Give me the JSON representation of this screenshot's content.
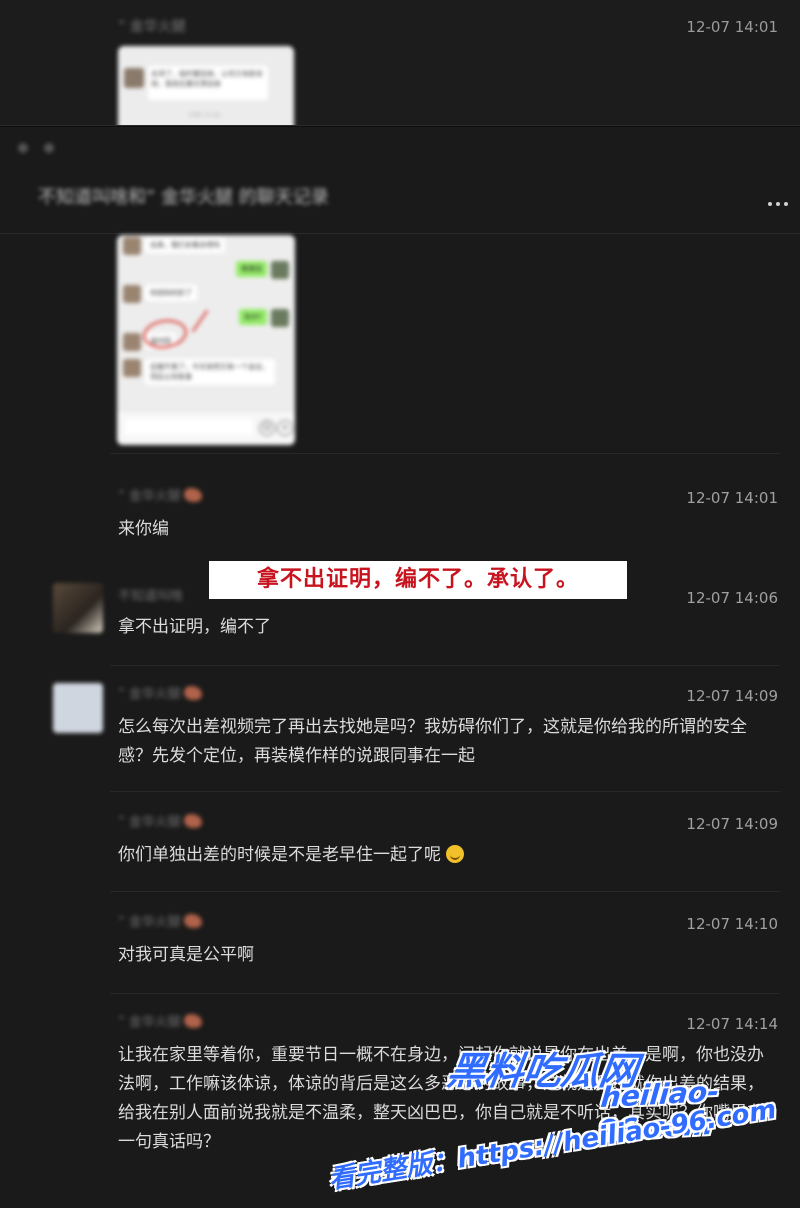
{
  "top_message": {
    "sender": "” 金华火腿",
    "time": "12-07 14:01",
    "thumbnail_text": "去领了，临时要回来，公司又有新安排，我现在要买票回来",
    "thumbnail_footer": "10月 11:41"
  },
  "chat_window": {
    "title": "不知道叫啥和” 金华火腿 的聊天记录",
    "screenshot_messages": [
      {
        "side": "left",
        "text": "出来，我们去看去吧吗"
      },
      {
        "side": "right",
        "text": "哪里回"
      },
      {
        "side": "left",
        "text": "你回你的好了"
      },
      {
        "side": "right",
        "text": "杭州?"
      },
      {
        "side": "left",
        "text": "温州回"
      },
      {
        "side": "left",
        "text": "忍摆不真了，今天突然又有一个会议，然后公司有事"
      }
    ]
  },
  "annotation_banner": "拿不出证明，编不了。承认了。",
  "messages": [
    {
      "sender": "” 金华火腿",
      "time": "12-07 14:01",
      "text": "来你编"
    },
    {
      "sender": "不知道叫啥",
      "time": "12-07 14:06",
      "text": "拿不出证明，编不了"
    },
    {
      "sender": "” 金华火腿",
      "time": "12-07 14:09",
      "text": "怎么每次出差视频完了再出去找她是吗？我妨碍你们了，这就是你给我的所谓的安全感？先发个定位，再装模作样的说跟同事在一起"
    },
    {
      "sender": "” 金华火腿",
      "time": "12-07 14:09",
      "text": "你们单独出差的时候是不是老早住一起了呢"
    },
    {
      "sender": "” 金华火腿",
      "time": "12-07 14:10",
      "text": "对我可真是公平啊"
    },
    {
      "sender": "” 金华火腿",
      "time": "12-07 14:14",
      "text": "让我在家里等着你，重要节日一概不在身边，问起你就说是你在出差，是啊，你也没办法啊，工作嘛该体谅，体谅的背后是这么多恶心的故事，这就是我迁就你出差的结果，给我在别人面前说我就是不温柔，整天凶巴巴，你自己就是不听话，其实呢？你嘴里有一句真话吗？"
    }
  ],
  "watermark": {
    "brand": "黑料吃瓜网",
    "domain": "heiliao-96.com",
    "full_version": "看完整版：https://heiliao-96.com"
  },
  "colors": {
    "banner_text": "#c8141e",
    "watermark": "#2f6cff",
    "background": "#1a1a1a"
  }
}
